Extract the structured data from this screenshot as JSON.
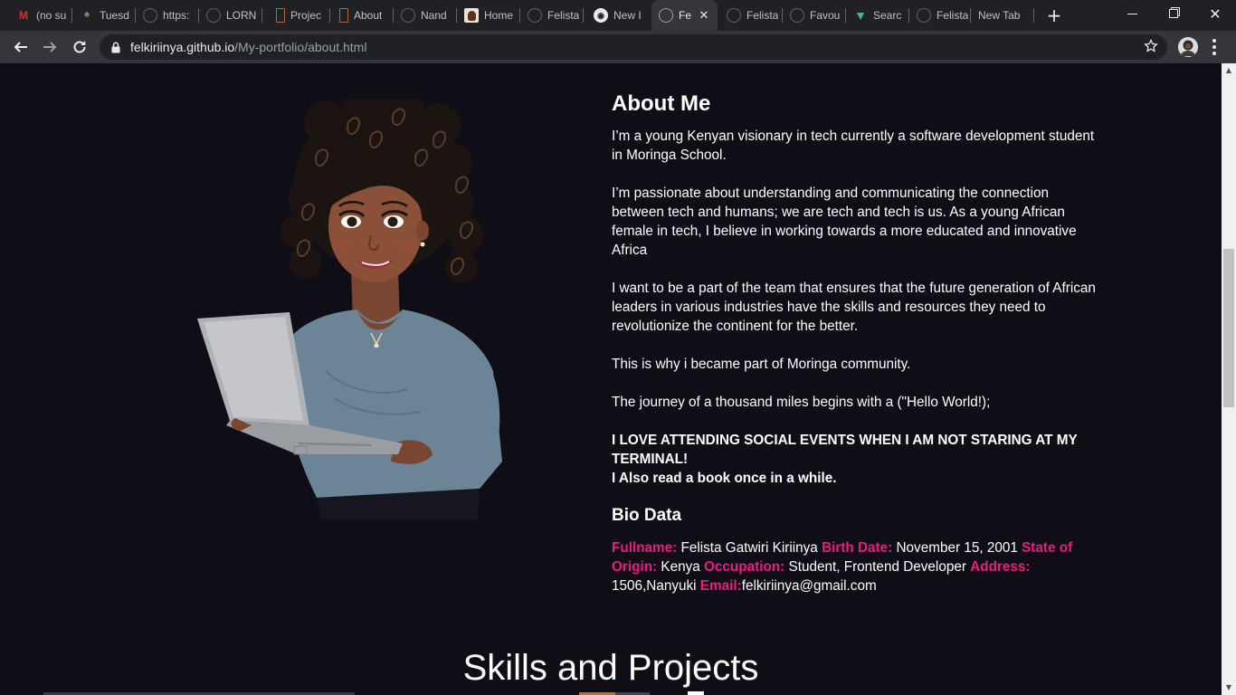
{
  "browser": {
    "tabs": [
      {
        "label": "(no su",
        "icon": "gmail-icon",
        "color": "#d93025"
      },
      {
        "label": "Tuesd",
        "icon": "tree-icon",
        "color": "#a08050"
      },
      {
        "label": "https:",
        "icon": "globe-icon",
        "color": "#5f6368"
      },
      {
        "label": "LORN",
        "icon": "globe-icon",
        "color": "#5f6368"
      },
      {
        "label": "Projec",
        "icon": "document-icon",
        "color": "#b0683a"
      },
      {
        "label": "About",
        "icon": "document-icon",
        "color": "#b0683a"
      },
      {
        "label": "Nand",
        "icon": "globe-icon",
        "color": "#5f6368"
      },
      {
        "label": "Home",
        "icon": "portrait-icon",
        "color": "#8a5a3a"
      },
      {
        "label": "Felista",
        "icon": "globe-icon",
        "color": "#5f6368"
      },
      {
        "label": "New I",
        "icon": "github-icon",
        "color": "#e8eaed"
      },
      {
        "label": "Fe",
        "icon": "globe-icon",
        "color": "#9aa0a6",
        "active": true
      },
      {
        "label": "Felista",
        "icon": "globe-icon",
        "color": "#5f6368"
      },
      {
        "label": "Favou",
        "icon": "globe-icon",
        "color": "#5f6368"
      },
      {
        "label": "Searc",
        "icon": "vue-icon",
        "color": "#41b883"
      },
      {
        "label": "Felista",
        "icon": "globe-icon",
        "color": "#5f6368"
      },
      {
        "label": "New Tab",
        "icon": "",
        "color": ""
      }
    ],
    "url_host": "felkiriinya.github.io",
    "url_path": "/My-portfolio/about.html"
  },
  "about": {
    "heading": "About Me",
    "paragraphs": [
      "I’m a young Kenyan visionary in tech currently a software development student in Moringa School.",
      "I’m passionate about understanding and communicating the connection between tech and humans; we are tech and tech is us. As a young African female in tech, I believe in working towards a more educated and innovative Africa",
      "I want to be a part of the team that ensures that the future generation of African leaders in various industries have the skills and resources they need to revolutionize the continent for the better.",
      "This is why i became part of Moringa community.",
      "The journey of a thousand miles begins with a (\"Hello World!);"
    ],
    "bold_lines": [
      "I LOVE ATTENDING SOCIAL EVENTS WHEN I AM NOT STARING AT MY TERMINAL!",
      "I Also read a book once in a while."
    ]
  },
  "bio": {
    "heading": "Bio Data",
    "fullname_label": "Fullname:",
    "fullname": " Felista Gatwiri Kiriinya ",
    "birth_label": "Birth Date:",
    "birth": " November 15, 2001 ",
    "origin_label": "State of Origin:",
    "origin": " Kenya ",
    "occupation_label": "Occupation:",
    "occupation": " Student, Frontend Developer ",
    "address_label": "Address:",
    "address": " 1506,Nanyuki ",
    "email_label": "Email:",
    "email": "felkiriinya@gmail.com"
  },
  "skills": {
    "heading": "Skills and Projects"
  },
  "colors": {
    "page_bg": "#0f0e17",
    "text": "#fffffe",
    "accent": "#e91e7d"
  }
}
